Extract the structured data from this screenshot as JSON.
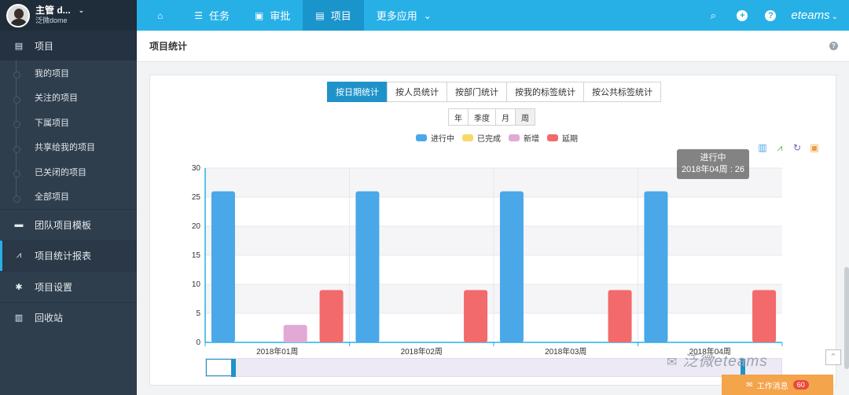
{
  "user": {
    "name": "主管 d...",
    "caret": "⌄",
    "sub": "泛微dome"
  },
  "nav": {
    "items": [
      {
        "label": "",
        "icon": "home-icon"
      },
      {
        "label": "任务",
        "icon": "list-icon"
      },
      {
        "label": "审批",
        "icon": "approve-icon"
      },
      {
        "label": "项目",
        "icon": "project-icon"
      },
      {
        "label": "更多应用",
        "icon": "chevron-down-icon"
      }
    ],
    "brand": "eteams"
  },
  "sidebar": {
    "group": "项目",
    "items": [
      "我的项目",
      "关注的项目",
      "下属项目",
      "共享给我的项目",
      "已关闭的项目",
      "全部项目"
    ],
    "main": [
      {
        "label": "团队项目模板",
        "icon": "template-icon"
      },
      {
        "label": "项目统计报表",
        "icon": "chart-line-icon"
      },
      {
        "label": "项目设置",
        "icon": "gear-icon"
      },
      {
        "label": "回收站",
        "icon": "trash-icon"
      }
    ]
  },
  "panel": {
    "title": "项目统计"
  },
  "tabs": [
    "按日期统计",
    "按人员统计",
    "按部门统计",
    "按我的标签统计",
    "按公共标签统计"
  ],
  "periods": [
    "年",
    "季度",
    "月",
    "周"
  ],
  "tooltip": {
    "series": "进行中",
    "value": "2018年04周 : 26"
  },
  "watermark": "泛微eteams",
  "message_button": {
    "label": "工作消息",
    "badge": "60"
  },
  "colors": {
    "in_progress": "#4aa7e8",
    "completed": "#f9d86a",
    "new": "#e2a9d6",
    "delayed": "#f26a6b"
  },
  "chart_data": {
    "type": "bar",
    "categories": [
      "2018年01周",
      "2018年02周",
      "2018年03周",
      "2018年04周"
    ],
    "series": [
      {
        "name": "进行中",
        "values": [
          26,
          26,
          26,
          26
        ]
      },
      {
        "name": "已完成",
        "values": [
          0,
          0,
          0,
          0
        ]
      },
      {
        "name": "新增",
        "values": [
          3,
          0,
          0,
          0
        ]
      },
      {
        "name": "延期",
        "values": [
          9,
          9,
          9,
          9
        ]
      }
    ],
    "ylim": [
      0,
      30
    ],
    "yticks": [
      0,
      5,
      10,
      15,
      20,
      25,
      30
    ],
    "legend": "top-center",
    "grid": true
  }
}
